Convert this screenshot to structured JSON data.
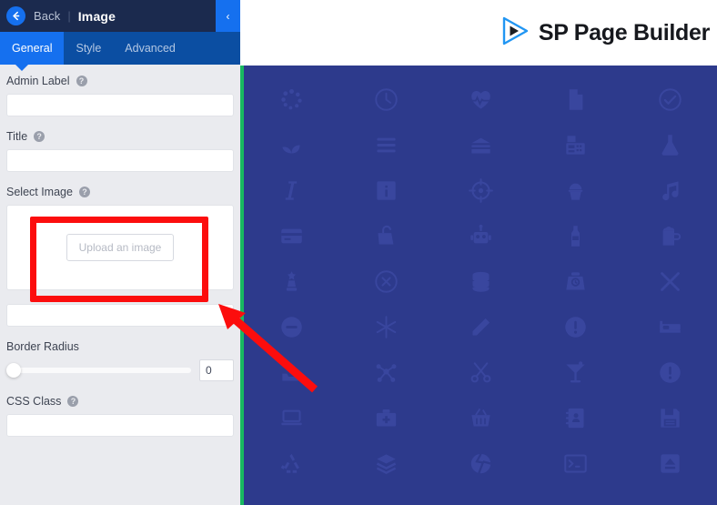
{
  "sidebar": {
    "header": {
      "back_label": "Back",
      "separator": "|",
      "title": "Image",
      "back_icon": "arrow-left-icon",
      "collapse_icon": "chevron-left-icon",
      "collapse_glyph": "‹"
    },
    "tabs": [
      {
        "label": "General",
        "active": true
      },
      {
        "label": "Style",
        "active": false
      },
      {
        "label": "Advanced",
        "active": false
      }
    ],
    "fields": {
      "admin_label": {
        "label": "Admin Label",
        "value": "",
        "help": "?"
      },
      "title": {
        "label": "Title",
        "value": "",
        "help": "?"
      },
      "select_image": {
        "label": "Select Image",
        "help": "?",
        "upload_button": "Upload an image"
      },
      "alt_text": {
        "value": ""
      },
      "border_radius": {
        "label": "Border Radius",
        "value": "0",
        "slider_percent": 0
      },
      "css_class": {
        "label": "CSS Class",
        "value": "",
        "help": "?"
      }
    }
  },
  "canvas": {
    "brand": {
      "text": "SP Page Builder",
      "logo_icon": "play-triangle-logo"
    },
    "icons": [
      "spinner-icon",
      "clock-icon",
      "heartbeat-icon",
      "file-icon",
      "check-circle-icon",
      "seedling-icon",
      "menu-bars-icon",
      "archive-icon",
      "fax-icon",
      "flask-icon",
      "italic-icon",
      "info-square-icon",
      "crosshair-icon",
      "cupcake-icon",
      "music-icon",
      "credit-card-icon",
      "bag-icon",
      "robot-icon",
      "bottle-icon",
      "beer-mug-icon",
      "chess-piece-icon",
      "x-circle-icon",
      "database-icon",
      "scale-icon",
      "close-x-icon",
      "minus-circle-icon",
      "asterisk-icon",
      "pen-icon",
      "exclamation-circle-icon",
      "bed-icon",
      "upload-tray-icon",
      "molecule-icon",
      "scissors-icon",
      "cocktail-icon",
      "exclamation-circle-icon",
      "laptop-icon",
      "medical-kit-icon",
      "basket-icon",
      "address-book-icon",
      "floppy-disk-icon",
      "recycle-icon",
      "layers-icon",
      "broken-circle-icon",
      "terminal-icon",
      "eject-icon"
    ]
  },
  "annotations": {
    "highlight_rect": {
      "shape": "rectangle",
      "color": "#fc0d0d",
      "target": "select-image-upload-zone"
    },
    "arrow": {
      "shape": "arrow",
      "color": "#fc0d0d",
      "points_to": "select-image-upload-zone"
    }
  },
  "colors": {
    "header_bg": "#1b2a4e",
    "tab_active": "#1570ef",
    "tabbar_bg": "#0b4ea2",
    "sidebar_bg": "#eaebef",
    "divider_green": "#18b861",
    "canvas_blue": "#2d3a8c",
    "annotation_red": "#fc0d0d"
  }
}
